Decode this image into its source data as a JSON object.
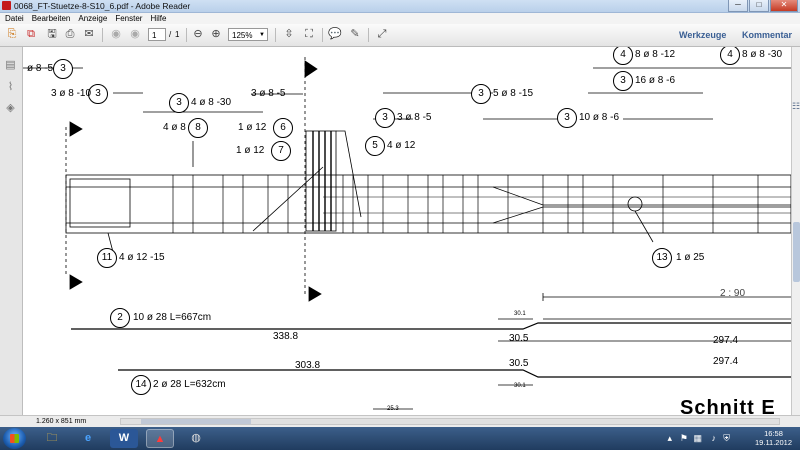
{
  "window": {
    "title": "0068_FT-Stuetze-8-S10_6.pdf - Adobe Reader",
    "minimize": "─",
    "maximize": "□",
    "close": "✕"
  },
  "menu": {
    "items": [
      "Datei",
      "Bearbeiten",
      "Anzeige",
      "Fenster",
      "Hilfe"
    ]
  },
  "toolbar": {
    "page_current": "1",
    "page_separator": "/",
    "page_total": "1",
    "zoom": "125%",
    "tools_label": "Werkzeuge",
    "comment_label": "Kommentar"
  },
  "drawing": {
    "labels": [
      "ø 8 -5",
      "3 ø 8 -10",
      "4 ø 8 -30",
      "3 ø 8 -5",
      "5 ø 8 -15",
      "8 ø 8 -12",
      "8 ø 8 -30",
      "16 ø 8 -6",
      "4 ø 8",
      "1 ø 12",
      "3 ø 8 -5",
      "10 ø 8 -6",
      "1 ø 12",
      "4 ø 12",
      "4 ø 12 -15",
      "1 ø 25",
      "2 : 90",
      "10 ø 28  L=667cm",
      "30.1",
      "338.8",
      "30.5",
      "297.4",
      "303.8",
      "30.5",
      "297.4",
      "2 ø 28  L=632cm",
      "30.1",
      "25.3"
    ],
    "circles": [
      "3",
      "3",
      "3",
      "3",
      "4",
      "4",
      "3",
      "8",
      "6",
      "3",
      "3",
      "7",
      "5",
      "11",
      "13",
      "2",
      "14"
    ],
    "heading": "Schnitt  E"
  },
  "status": {
    "page_size": "1.260 x 851 mm"
  },
  "taskbar": {
    "time": "16:58",
    "date": "19.11.2012"
  }
}
